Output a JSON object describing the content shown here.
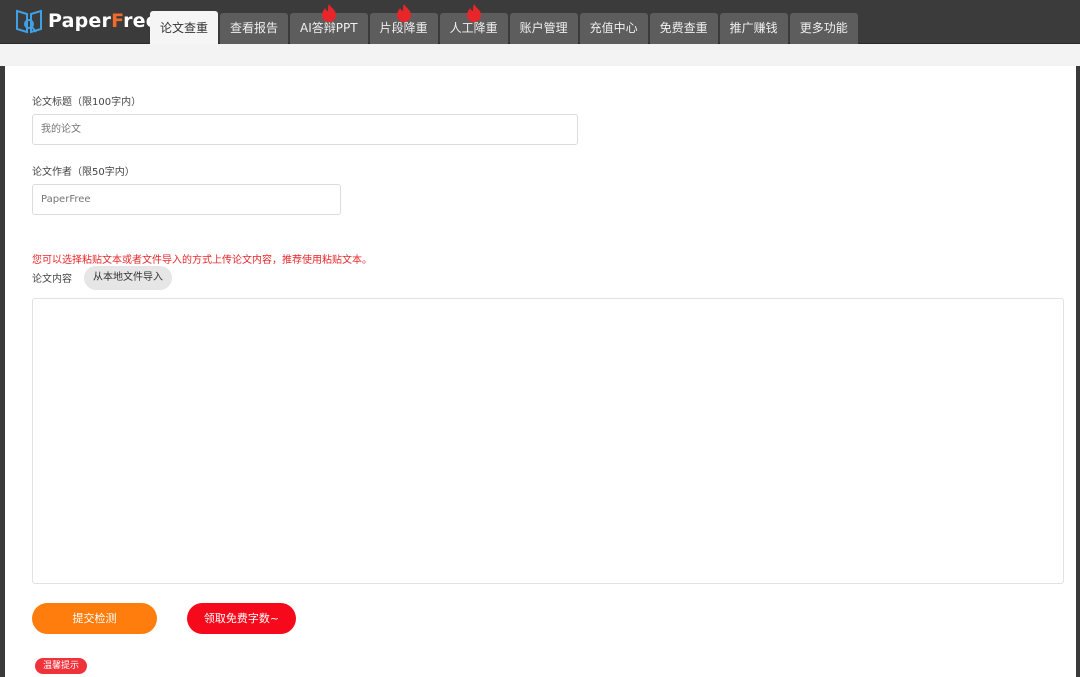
{
  "app": {
    "logo_main": "Paper",
    "logo_accent": "F",
    "logo_rest": "ree"
  },
  "tabs": [
    {
      "label": "论文查重",
      "active": true,
      "hot": false
    },
    {
      "label": "查看报告",
      "active": false,
      "hot": false
    },
    {
      "label": "AI答辩PPT",
      "active": false,
      "hot": true
    },
    {
      "label": "片段降重",
      "active": false,
      "hot": true
    },
    {
      "label": "人工降重",
      "active": false,
      "hot": true
    },
    {
      "label": "账户管理",
      "active": false,
      "hot": false
    },
    {
      "label": "充值中心",
      "active": false,
      "hot": false
    },
    {
      "label": "免费查重",
      "active": false,
      "hot": false
    },
    {
      "label": "推广赚钱",
      "active": false,
      "hot": false
    },
    {
      "label": "更多功能",
      "active": false,
      "hot": false
    }
  ],
  "form": {
    "title_label": "论文标题（限100字内）",
    "title_placeholder": "我的论文",
    "author_label": "论文作者（限50字内）",
    "author_placeholder": "PaperFree",
    "notice": "您可以选择粘贴文本或者文件导入的方式上传论文内容，推荐使用粘贴文本。",
    "content_label": "论文内容",
    "import_label": "从本地文件导入",
    "content_placeholder": ""
  },
  "actions": {
    "submit_label": "提交检测",
    "free_label": "领取免费字数~"
  },
  "tip": {
    "label": "温馨提示"
  },
  "colors": {
    "topbar": "#3b3b3b",
    "tab": "#5d5d5d",
    "submit": "#ff7d0d",
    "free": "#f5091a",
    "notice": "#e8262a",
    "hot": "#e8262a"
  }
}
